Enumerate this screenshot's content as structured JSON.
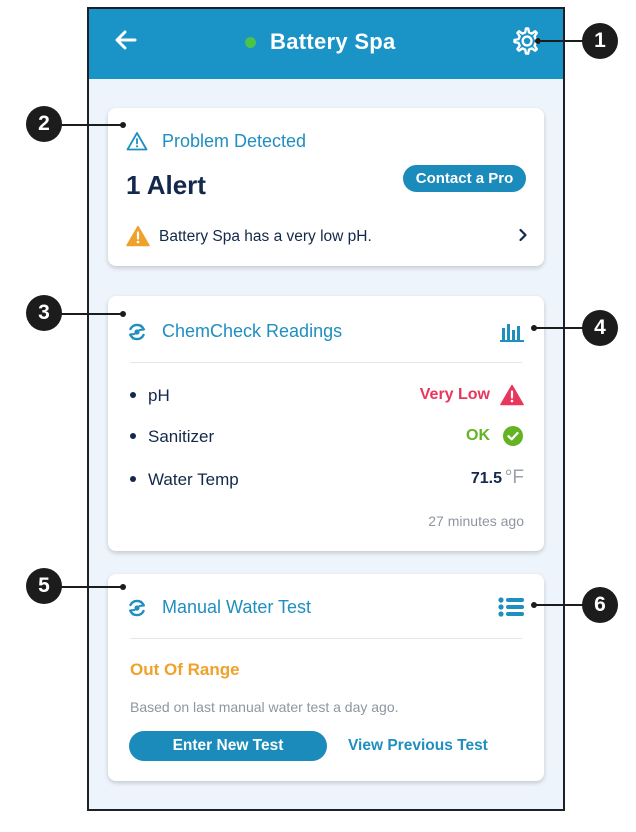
{
  "header": {
    "title": "Battery Spa",
    "status_color": "#4cc24a",
    "back_icon": "back-arrow-icon",
    "settings_icon": "gear-icon"
  },
  "alerts": {
    "heading": "Problem Detected",
    "count_label": "1 Alert",
    "contact_button": "Contact a Pro",
    "items": [
      {
        "text": "Battery Spa has a very low pH."
      }
    ]
  },
  "chemcheck": {
    "heading": "ChemCheck Readings",
    "chart_icon": "bar-chart-icon",
    "readings": [
      {
        "label": "pH",
        "value": "Very Low",
        "status": "warning",
        "color": "#e8365d"
      },
      {
        "label": "Sanitizer",
        "value": "OK",
        "status": "ok",
        "color": "#63b323"
      },
      {
        "label": "Water Temp",
        "value": "71.5",
        "unit": "°F",
        "color": "#13284a"
      }
    ],
    "updated": "27 minutes ago"
  },
  "manual_test": {
    "heading": "Manual Water Test",
    "list_icon": "list-icon",
    "status": "Out Of Range",
    "status_color": "#f0a12b",
    "description": "Based on last manual water test a day ago.",
    "enter_button": "Enter New Test",
    "view_button": "View Previous Test"
  },
  "callouts": [
    "1",
    "2",
    "3",
    "4",
    "5",
    "6"
  ],
  "colors": {
    "primary": "#1a93c6",
    "text_dark": "#13284a",
    "background": "#eef4fb"
  }
}
